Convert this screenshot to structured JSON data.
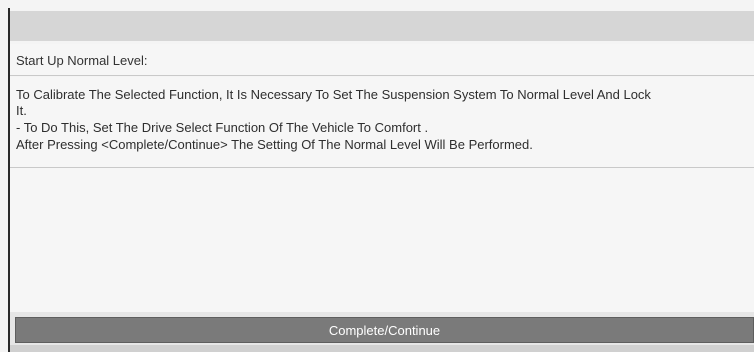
{
  "section": {
    "label": "Start Up Normal Level:"
  },
  "instructions": {
    "line1": "To Calibrate The Selected Function, It Is Necessary To Set The Suspension System To Normal Level And Lock",
    "line2": "It.",
    "line3": "- To Do This, Set The Drive Select Function Of The Vehicle To Comfort .",
    "line4": "After Pressing <Complete/Continue> The Setting Of The Normal Level Will Be Performed."
  },
  "actions": {
    "complete_label": "Complete/Continue"
  }
}
